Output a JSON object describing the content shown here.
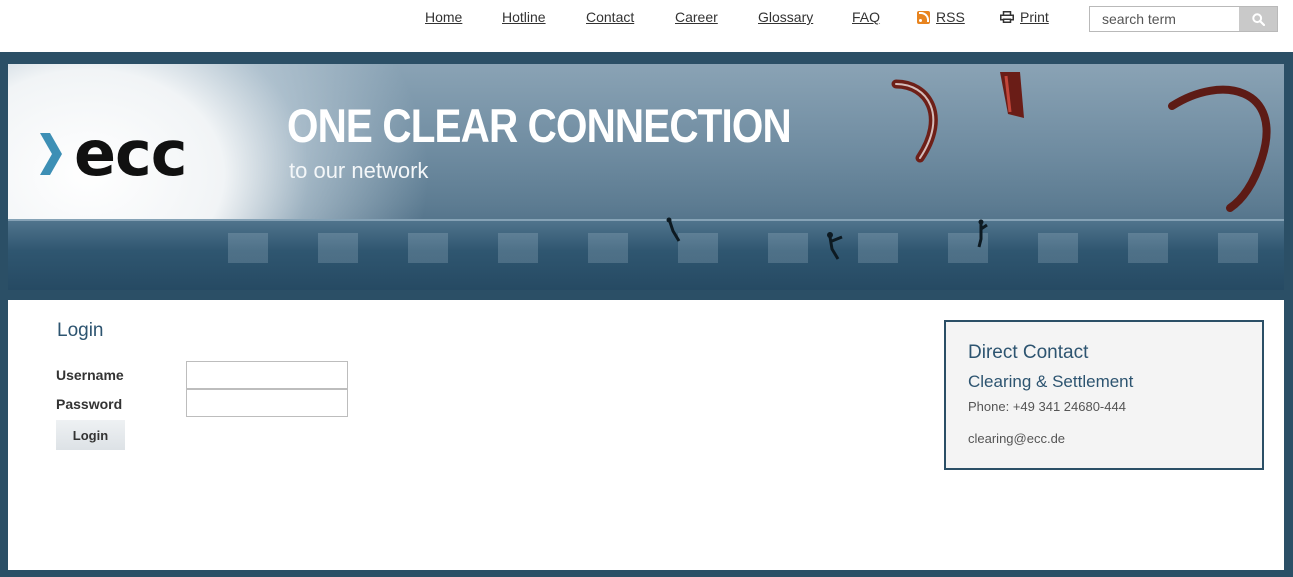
{
  "nav": {
    "home": "Home",
    "hotline": "Hotline",
    "contact": "Contact",
    "career": "Career",
    "glossary": "Glossary",
    "faq": "FAQ",
    "rss": "RSS",
    "print": "Print"
  },
  "search": {
    "placeholder": "search term"
  },
  "banner": {
    "logo_text": "ecc",
    "headline": "ONE CLEAR CONNECTION",
    "subline": "to our network"
  },
  "login": {
    "title": "Login",
    "username_label": "Username",
    "password_label": "Password",
    "button_label": "Login"
  },
  "contact_box": {
    "title": "Direct Contact",
    "subtitle": "Clearing & Settlement",
    "phone": "Phone: +49 341 24680-444",
    "email": "clearing@ecc.de"
  },
  "colors": {
    "brand_dark": "#2b4f66",
    "brand_text": "#2d5470",
    "logo_chevron": "#3d8fb5",
    "rss_orange": "#e8841f"
  },
  "icons": [
    "rss-icon",
    "print-icon",
    "search-icon",
    "logo-chevron-icon"
  ]
}
